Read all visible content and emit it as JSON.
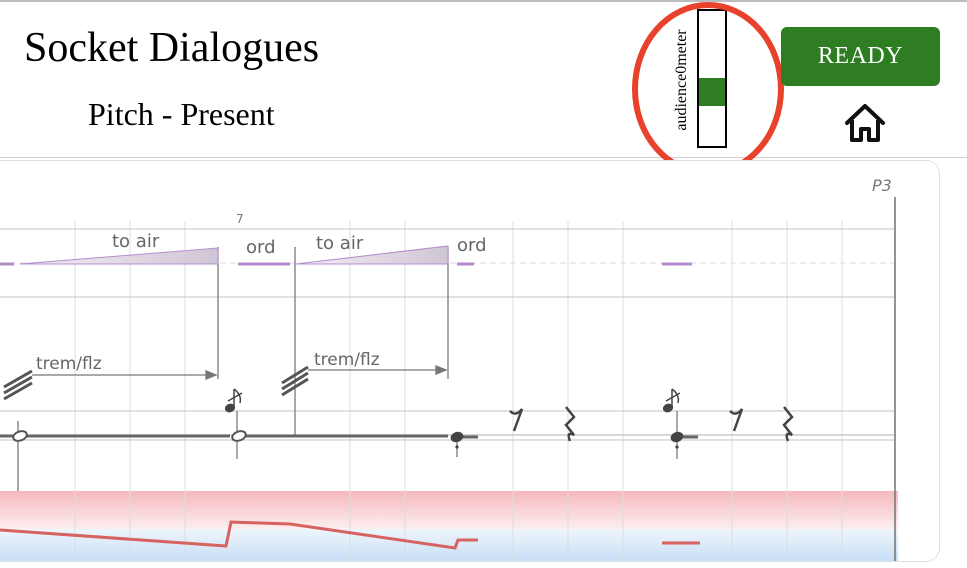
{
  "header": {
    "title": "Socket Dialogues",
    "subtitle": "Pitch - Present"
  },
  "audience_meter": {
    "label": "audience0meter",
    "level": 0.4,
    "fill_color": "#2e7d23"
  },
  "ready_button": {
    "label": "READY",
    "color": "#2e7d23"
  },
  "home": {
    "icon": "home-icon"
  },
  "score": {
    "page_label": "P3",
    "bar_number": "7",
    "annotations": {
      "to_air_1": "to air",
      "ord_1": "ord",
      "to_air_2": "to air",
      "ord_2": "ord",
      "trem_1": "trem/flz",
      "trem_2": "trem/flz"
    },
    "colors": {
      "pink_band": "#f7c9cc",
      "blue_band": "#cfe3f7",
      "red_line": "#d6635f",
      "purple": "#b48ccd"
    }
  }
}
